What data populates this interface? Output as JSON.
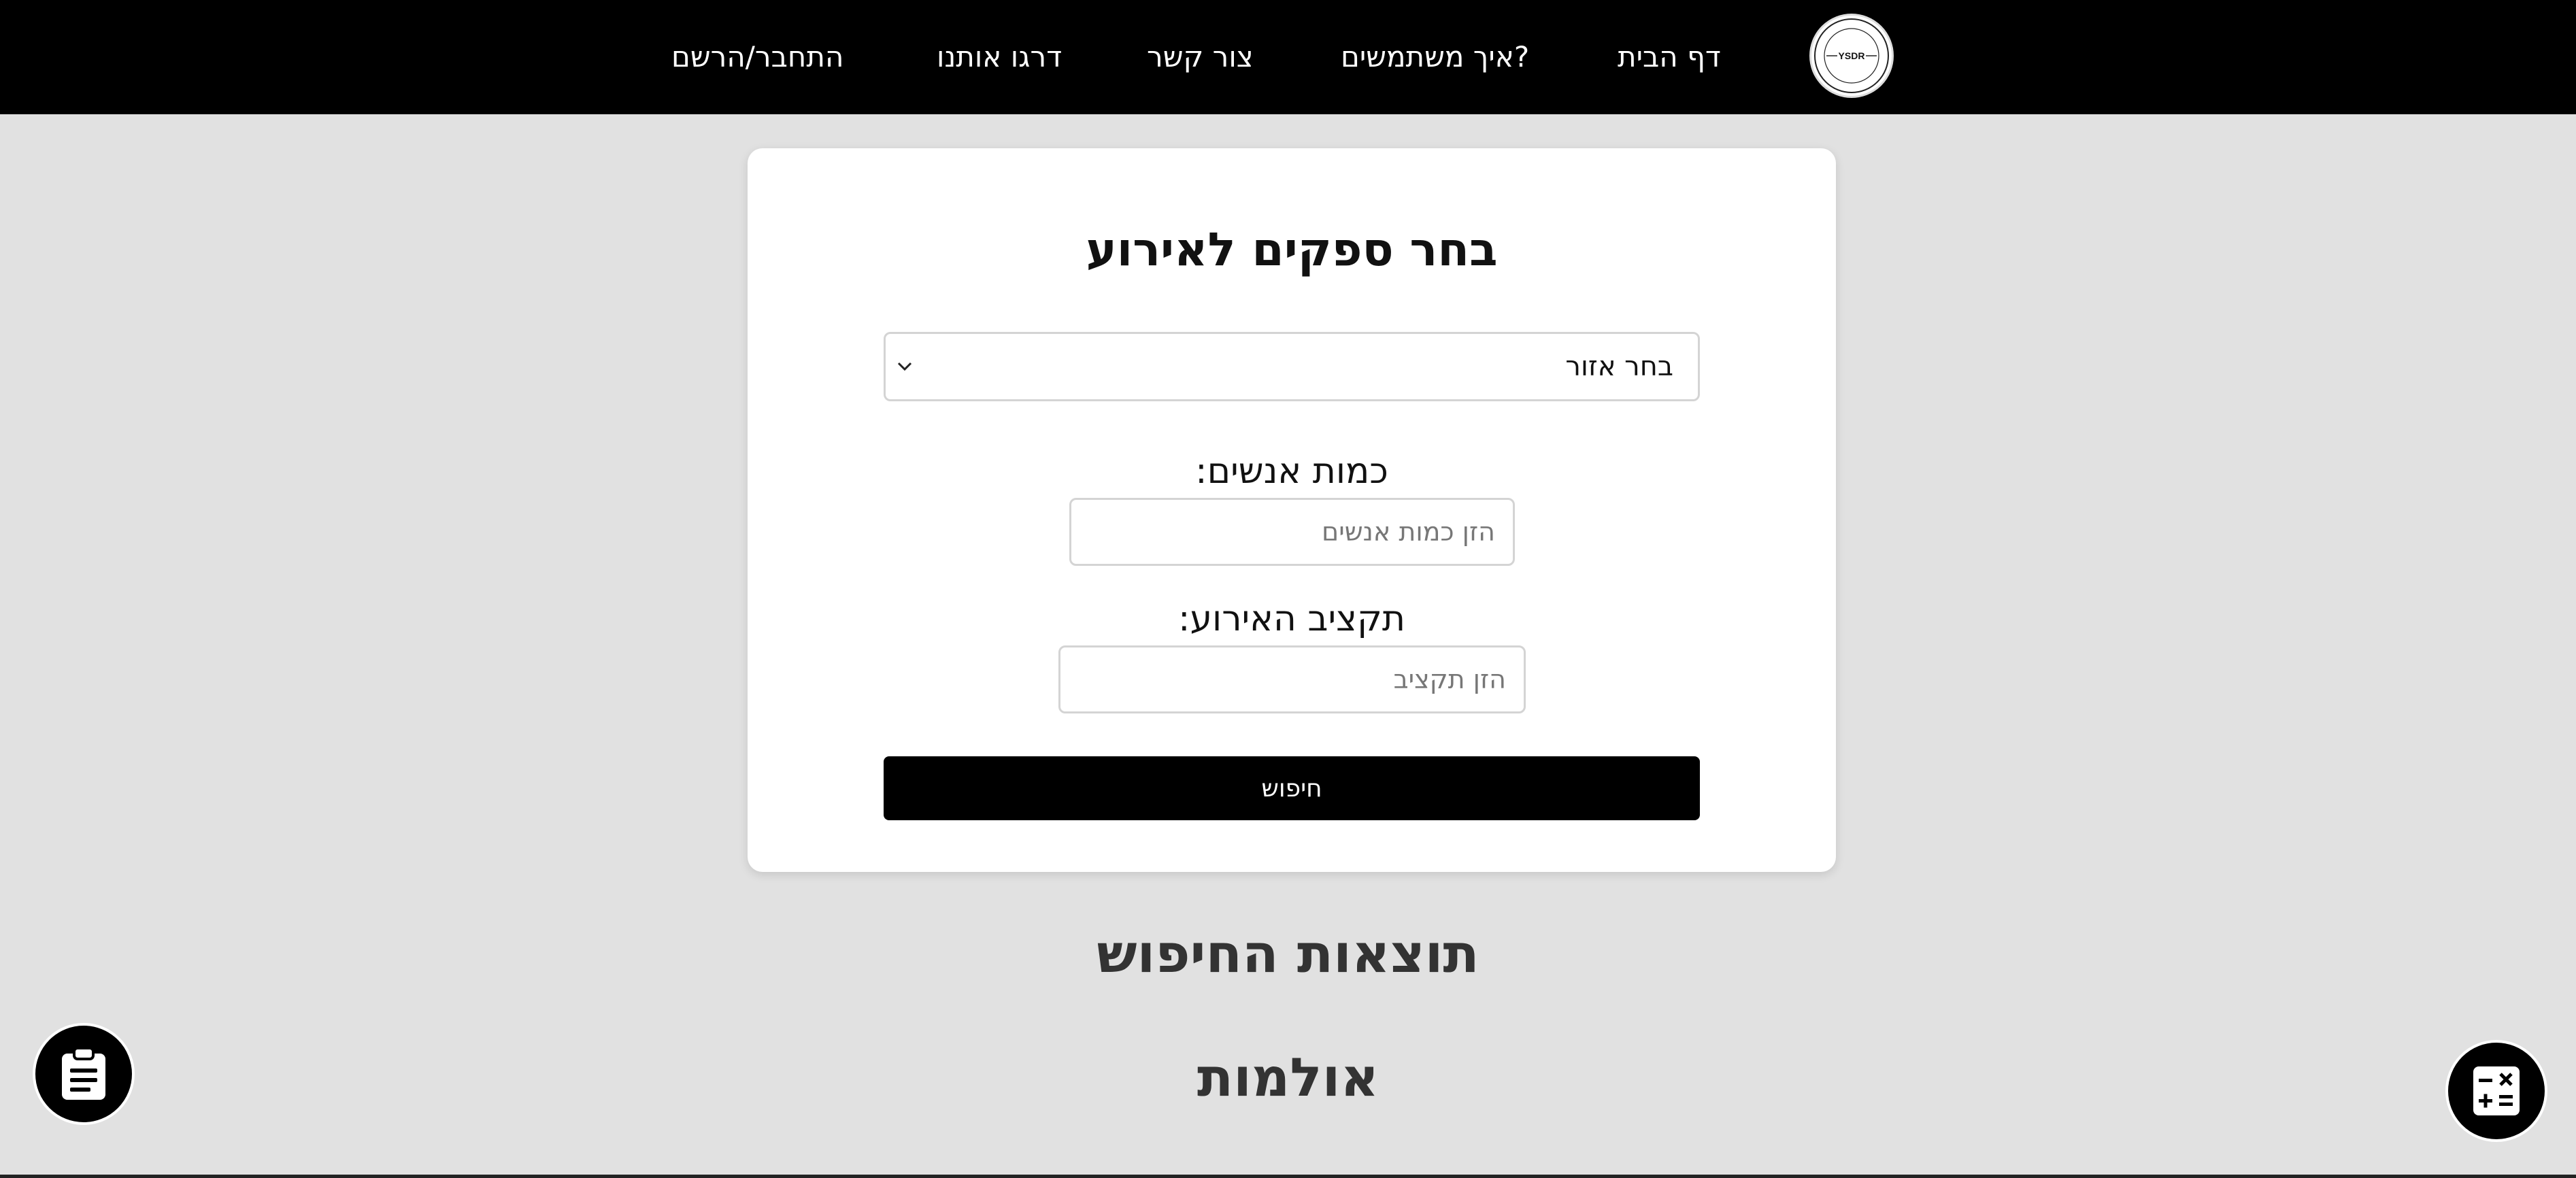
{
  "nav": {
    "logo_text": "YSDR",
    "links": [
      "דף הבית",
      "איך משתמשים?",
      "צור קשר",
      "דרגו אותנו",
      "התחבר/הרשם"
    ]
  },
  "form": {
    "title": "בחר ספקים לאירוע",
    "region_select": {
      "selected": "בחר אזור"
    },
    "guests_label": "כמות אנשים:",
    "guests_placeholder": "הזן כמות אנשים",
    "guests_value": "",
    "budget_label": "תקציב האירוע:",
    "budget_placeholder": "הזן תקציב",
    "budget_value": "",
    "search_button": "חיפוש"
  },
  "results": {
    "title": "תוצאות החיפוש",
    "section_halls": "אולמות"
  },
  "floating": {
    "left_icon": "clipboard-icon",
    "right_icon": "calculator-icon"
  },
  "colors": {
    "nav_background": "#000000",
    "page_background": "#e1e1e1",
    "button_background": "#000000"
  }
}
